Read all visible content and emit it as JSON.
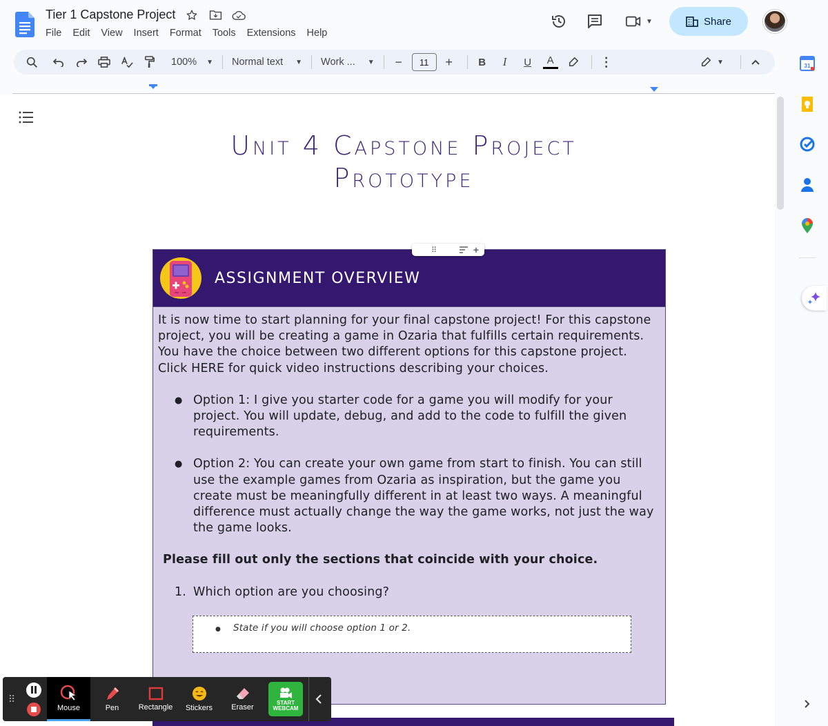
{
  "header": {
    "title": "Tier 1 Capstone Project",
    "menu": [
      "File",
      "Edit",
      "View",
      "Insert",
      "Format",
      "Tools",
      "Extensions",
      "Help"
    ],
    "share_label": "Share"
  },
  "toolbar": {
    "zoom": "100%",
    "style": "Normal text",
    "font": "Work ...",
    "font_size": "11",
    "bold": "B",
    "italic": "I",
    "underline": "U",
    "text_color": "A"
  },
  "document": {
    "title_line1": "Unit 4 Capstone Project",
    "title_line2": "Prototype",
    "card": {
      "title": "ASSIGNMENT OVERVIEW",
      "intro": "It is now time to start planning for your final capstone project!  For this capstone project, you will be creating a game in Ozaria that fulfills certain requirements.  You have the choice between two different options for this capstone project. Click HERE for quick video instructions describing your choices.",
      "options": [
        "Option 1: I give you starter code for a game you will modify for your project. You will update, debug, and add to the code to fulfill the given requirements.",
        "Option 2: You can create your own game from start to finish.  You can still use the example games from Ozaria as inspiration, but the game you create must be meaningfully different in at least two ways.  A meaningful difference must actually change the way the game works, not just the way the game looks."
      ],
      "instruction": "Please fill out only the sections that coincide with your choice.",
      "question_number": "1.",
      "question": "Which option are you choosing?",
      "answer_hint": "State if you will choose option 1 or 2."
    }
  },
  "recorder": {
    "tools": [
      "Mouse",
      "Pen",
      "Rectangle",
      "Stickers",
      "Eraser"
    ],
    "webcam_line1": "START",
    "webcam_line2": "WEBCAM"
  },
  "colors": {
    "accent": "#34186f",
    "card_bg": "#d9d1ea",
    "title_color": "#3a2678",
    "share_bg": "#c2e7ff",
    "webcam_green": "#2fb53e"
  }
}
